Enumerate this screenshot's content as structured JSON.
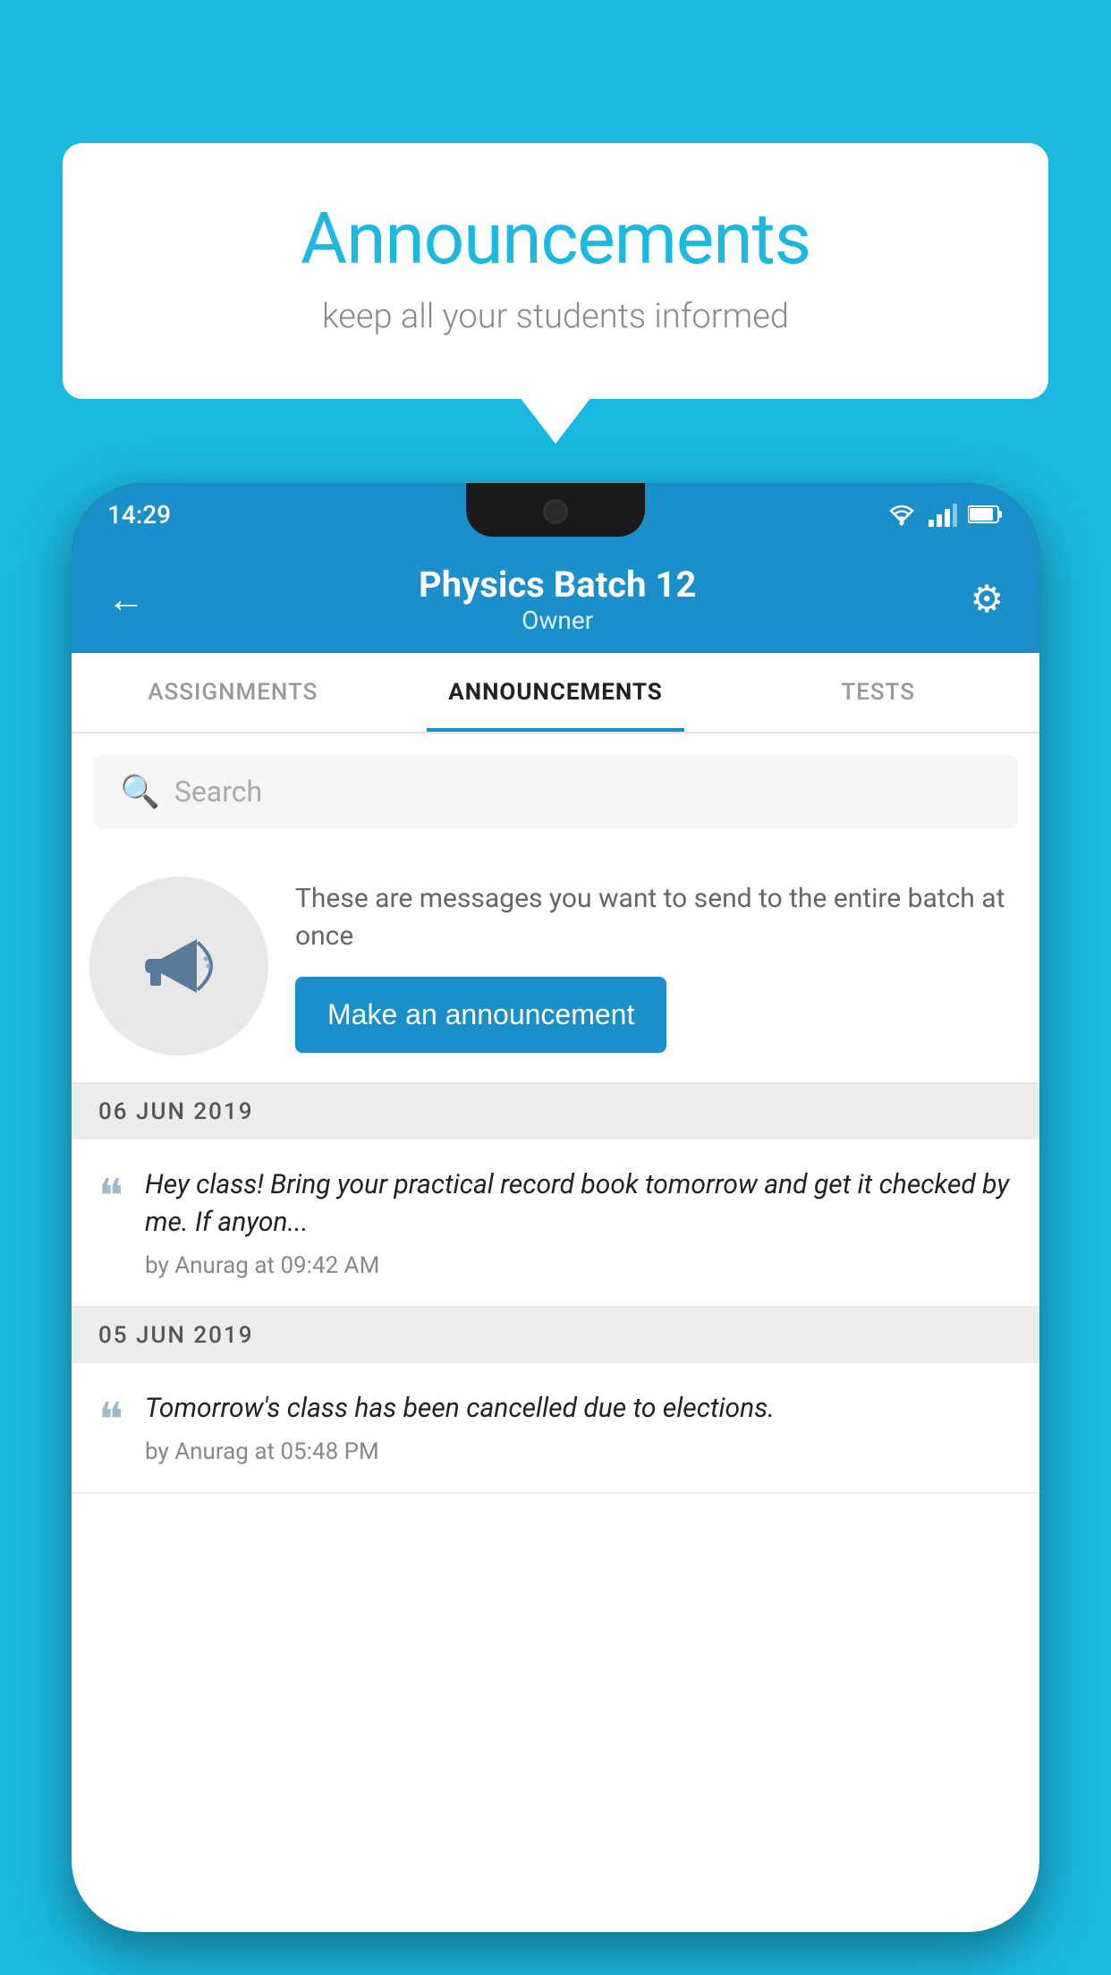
{
  "background_color": "#1bb8e0",
  "speech_bubble": {
    "title": "Announcements",
    "subtitle": "keep all your students informed"
  },
  "phone": {
    "status_bar": {
      "time": "14:29",
      "icons": [
        "wifi",
        "signal",
        "battery"
      ]
    },
    "top_bar": {
      "title": "Physics Batch 12",
      "subtitle": "Owner",
      "back_label": "←",
      "gear_label": "⚙"
    },
    "tabs": [
      {
        "label": "ASSIGNMENTS",
        "active": false
      },
      {
        "label": "ANNOUNCEMENTS",
        "active": true
      },
      {
        "label": "TESTS",
        "active": false
      }
    ],
    "search": {
      "placeholder": "Search"
    },
    "promo": {
      "description": "These are messages you want to send to the entire batch at once",
      "button_label": "Make an announcement"
    },
    "announcements": [
      {
        "date": "06  JUN  2019",
        "text": "Hey class! Bring your practical record book tomorrow and get it checked by me. If anyon...",
        "meta": "by Anurag at 09:42 AM"
      },
      {
        "date": "05  JUN  2019",
        "text": "Tomorrow's class has been cancelled due to elections.",
        "meta": "by Anurag at 05:48 PM"
      }
    ]
  }
}
